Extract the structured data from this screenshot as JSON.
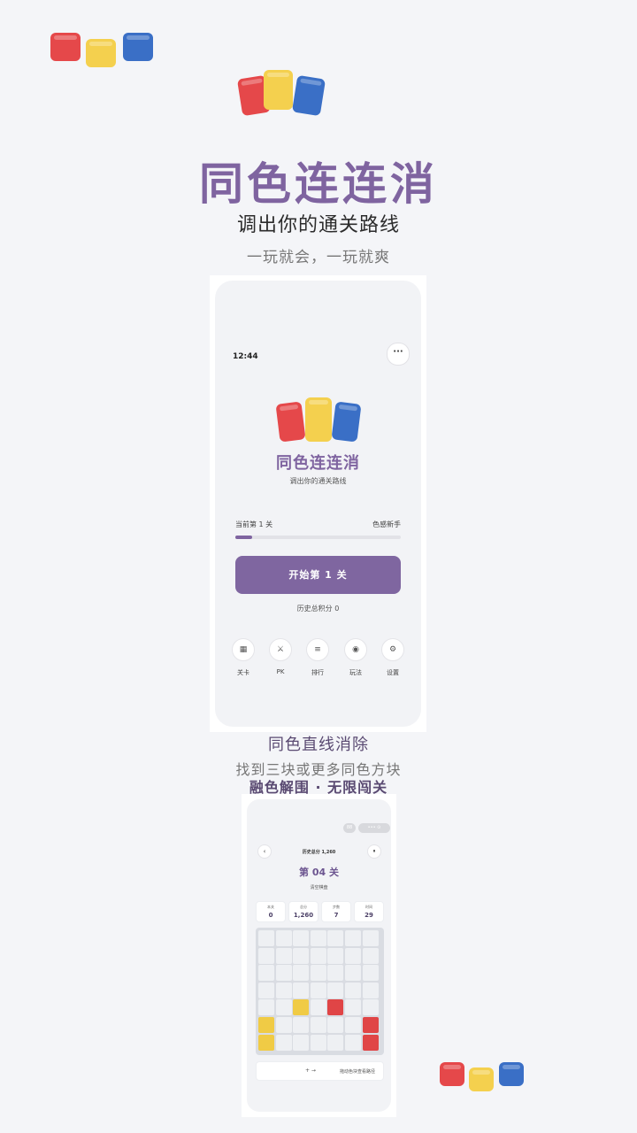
{
  "hero": {
    "title": "同色连连消",
    "subtitle": "调出你的通关路线",
    "tagline": "一玩就会，一玩就爽"
  },
  "phone1": {
    "status_time": "12:44",
    "menu_label": "···",
    "title": "同色连连消",
    "subtitle": "调出你的通关路线",
    "current_level": "当前第 1 关",
    "rank": "色感新手",
    "progress_percent": 10,
    "start_button": "开始第 1 关",
    "history_score": "历史总积分 0",
    "nav": [
      {
        "label": "关卡",
        "icon": "grid-icon",
        "glyph": "▦"
      },
      {
        "label": "PK",
        "icon": "swords-icon",
        "glyph": "⚔"
      },
      {
        "label": "排行",
        "icon": "list-icon",
        "glyph": "≡"
      },
      {
        "label": "玩法",
        "icon": "target-icon",
        "glyph": "◉"
      },
      {
        "label": "设置",
        "icon": "gear-icon",
        "glyph": "⚙"
      }
    ]
  },
  "captions": {
    "line1": "同色直线消除",
    "line2": "找到三块或更多同色方块",
    "line3": "融色解围 ·  无限闯关"
  },
  "phone2": {
    "pill_a": "88",
    "pill_b": "•••  ⊙",
    "back_label": "‹",
    "pause_label": "⏸",
    "history_total": "历史总分 1,260",
    "level_title": "第 04 关",
    "goal": "清空棋盘",
    "stats": [
      {
        "label": "本关",
        "value": "0"
      },
      {
        "label": "总分",
        "value": "1,260"
      },
      {
        "label": "步数",
        "value": "7"
      },
      {
        "label": "时间",
        "value": "29"
      }
    ],
    "board": {
      "columns": 7,
      "rows": 7,
      "tiles": [
        {
          "row": 4,
          "col": 2,
          "color": "yellow"
        },
        {
          "row": 4,
          "col": 4,
          "color": "red"
        },
        {
          "row": 5,
          "col": 0,
          "color": "yellow"
        },
        {
          "row": 5,
          "col": 6,
          "color": "red"
        },
        {
          "row": 6,
          "col": 0,
          "color": "yellow"
        },
        {
          "row": 6,
          "col": 6,
          "color": "red"
        }
      ]
    },
    "hint_arrows": "+       →",
    "hint_text": "拖动色块查看路径"
  },
  "colors": {
    "brand_purple": "#7f64a0",
    "tile_red": "#e5484a",
    "tile_yellow": "#f4d04e",
    "tile_blue": "#3a6fc6"
  }
}
